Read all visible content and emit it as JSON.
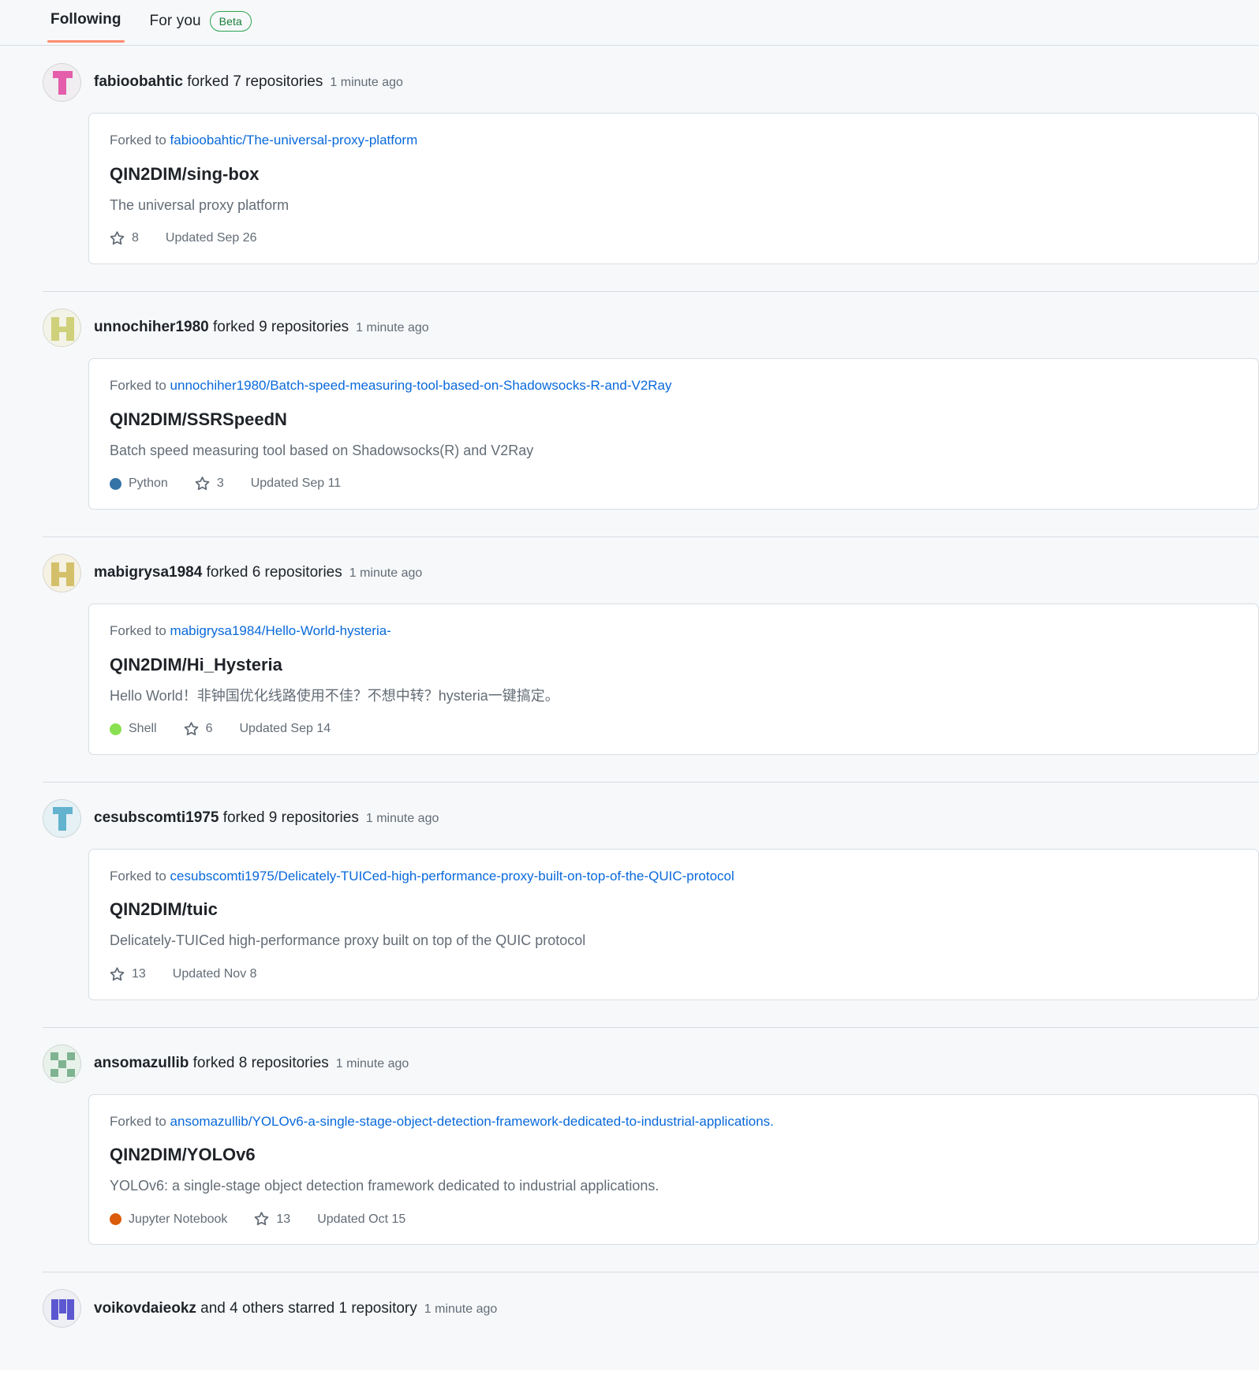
{
  "tabs": [
    {
      "label": "Following",
      "active": true,
      "badge": null
    },
    {
      "label": "For you",
      "active": false,
      "badge": "Beta"
    }
  ],
  "colors": {
    "tab_underline": "#fd8c73",
    "link": "#0969da",
    "beta_border": "#2da44e",
    "beta_text": "#1a7f37",
    "muted": "#636c76",
    "card_bg": "#ffffff",
    "feed_bg": "#f6f8fa",
    "border": "#d8dee4"
  },
  "feed": [
    {
      "actor": "fabioobahtic",
      "action": "forked 7 repositories",
      "timestamp": "1 minute ago",
      "avatar": {
        "bg": "#f0eef1",
        "fg": "#e45eab",
        "pattern": "t-shape"
      },
      "card": {
        "forked_to_label": "Forked to",
        "forked_to_link": "fabioobahtic/The-universal-proxy-platform",
        "repo": "QIN2DIM/sing-box",
        "description": "The universal proxy platform",
        "language": null,
        "language_color": null,
        "stars": "8",
        "updated": "Updated Sep 26"
      }
    },
    {
      "actor": "unnochiher1980",
      "action": "forked 9 repositories",
      "timestamp": "1 minute ago",
      "avatar": {
        "bg": "#f3f3e7",
        "fg": "#cfd07a",
        "pattern": "h-shape"
      },
      "card": {
        "forked_to_label": "Forked to",
        "forked_to_link": "unnochiher1980/Batch-speed-measuring-tool-based-on-Shadowsocks-R-and-V2Ray",
        "repo": "QIN2DIM/SSRSpeedN",
        "description": "Batch speed measuring tool based on Shadowsocks(R) and V2Ray",
        "language": "Python",
        "language_color": "#3572A5",
        "stars": "3",
        "updated": "Updated Sep 11"
      }
    },
    {
      "actor": "mabigrysa1984",
      "action": "forked 6 repositories",
      "timestamp": "1 minute ago",
      "avatar": {
        "bg": "#f5f1e3",
        "fg": "#d4c06a",
        "pattern": "h-shape"
      },
      "card": {
        "forked_to_label": "Forked to",
        "forked_to_link": "mabigrysa1984/Hello-World-hysteria-",
        "repo": "QIN2DIM/Hi_Hysteria",
        "description": "Hello World！非钟国优化线路使用不佳？不想中转？hysteria一键搞定。",
        "language": "Shell",
        "language_color": "#89e051",
        "stars": "6",
        "updated": "Updated Sep 14"
      }
    },
    {
      "actor": "cesubscomti1975",
      "action": "forked 9 repositories",
      "timestamp": "1 minute ago",
      "avatar": {
        "bg": "#e6f1f5",
        "fg": "#63b3cf",
        "pattern": "t-shape"
      },
      "card": {
        "forked_to_label": "Forked to",
        "forked_to_link": "cesubscomti1975/Delicately-TUICed-high-performance-proxy-built-on-top-of-the-QUIC-protocol",
        "repo": "QIN2DIM/tuic",
        "description": "Delicately-TUICed high-performance proxy built on top of the QUIC protocol",
        "language": null,
        "language_color": null,
        "stars": "13",
        "updated": "Updated Nov 8"
      }
    },
    {
      "actor": "ansomazullib",
      "action": "forked 8 repositories",
      "timestamp": "1 minute ago",
      "avatar": {
        "bg": "#e8f2ea",
        "fg": "#7fb391",
        "pattern": "grid-shape"
      },
      "card": {
        "forked_to_label": "Forked to",
        "forked_to_link": "ansomazullib/YOLOv6-a-single-stage-object-detection-framework-dedicated-to-industrial-applications.",
        "repo": "QIN2DIM/YOLOv6",
        "description": "YOLOv6: a single-stage object detection framework dedicated to industrial applications.",
        "language": "Jupyter Notebook",
        "language_color": "#DA5B0B",
        "stars": "13",
        "updated": "Updated Oct 15"
      }
    },
    {
      "actor": "voikovdaieokz",
      "action": "and 4 others starred 1 repository",
      "timestamp": "1 minute ago",
      "avatar": {
        "bg": "#eeeef5",
        "fg": "#5b57d1",
        "pattern": "m-shape"
      },
      "card": null
    }
  ]
}
